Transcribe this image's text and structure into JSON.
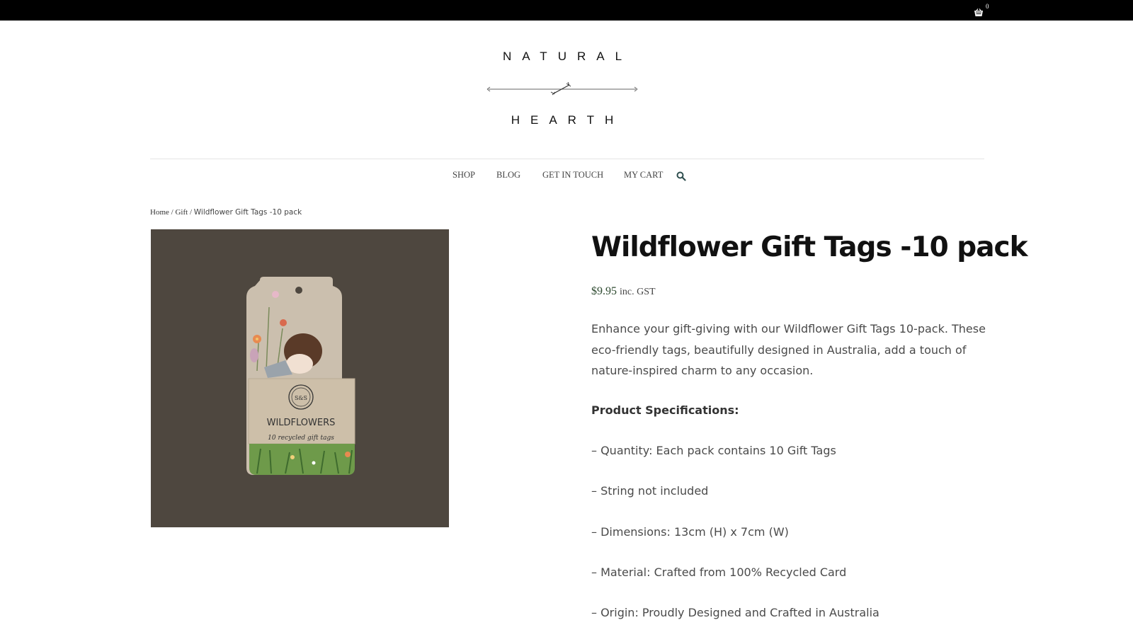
{
  "cart": {
    "count": "0",
    "icon": "basket-icon"
  },
  "logo": {
    "line1": "NATURAL",
    "line2": "HEARTH"
  },
  "nav": {
    "items": [
      {
        "label": "SHOP"
      },
      {
        "label": "BLOG"
      },
      {
        "label": "GET IN TOUCH"
      },
      {
        "label": "MY CART"
      }
    ],
    "search_icon": "search-icon"
  },
  "breadcrumb": {
    "home": "Home",
    "sep1": " / ",
    "category": "Gift",
    "sep2": " / ",
    "current": "Wildflower Gift Tags -10 pack"
  },
  "product": {
    "image_alt": "Wildflowers recycled gift tags pack",
    "packaging_text": "WILDFLOWERS",
    "packaging_subtext": "10 recycled gift tags",
    "title": "Wildflower Gift Tags -10 pack",
    "price": "$9.95",
    "price_suffix": "inc. GST",
    "description": "Enhance your gift-giving with our Wildflower Gift Tags 10-pack. These eco-friendly tags, beautifully designed in Australia, add a touch of nature-inspired charm to any occasion.",
    "spec_heading": "Product Specifications:",
    "specs": [
      "– Quantity: Each pack contains 10 Gift Tags",
      "– String not included",
      "– Dimensions: 13cm (H) x 7cm (W)",
      "– Material: Crafted from 100% Recycled Card",
      "– Origin: Proudly Designed and Crafted in Australia"
    ]
  },
  "colors": {
    "topbar": "#000000",
    "image_background": "#4e473f",
    "price": "#2d4a2f"
  }
}
